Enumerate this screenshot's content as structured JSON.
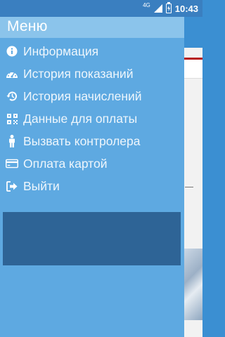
{
  "status_bar": {
    "network": "4G",
    "time": "10:43"
  },
  "drawer": {
    "title": "Меню",
    "items": [
      {
        "label": "Информация",
        "icon": "info-icon"
      },
      {
        "label": "История показаний",
        "icon": "gauge-icon"
      },
      {
        "label": "История начислений",
        "icon": "history-icon"
      },
      {
        "label": "Данные для оплаты",
        "icon": "qr-code-icon"
      },
      {
        "label": "Вызвать контролера",
        "icon": "person-icon"
      },
      {
        "label": "Оплата картой",
        "icon": "credit-card-icon"
      },
      {
        "label": "Выйти",
        "icon": "sign-out-icon"
      }
    ]
  },
  "colors": {
    "drawer_background": "#5ea9e1",
    "drawer_header": "#8bc4eb",
    "status_bar": "#3a7fc0",
    "block": "#2e6496"
  }
}
